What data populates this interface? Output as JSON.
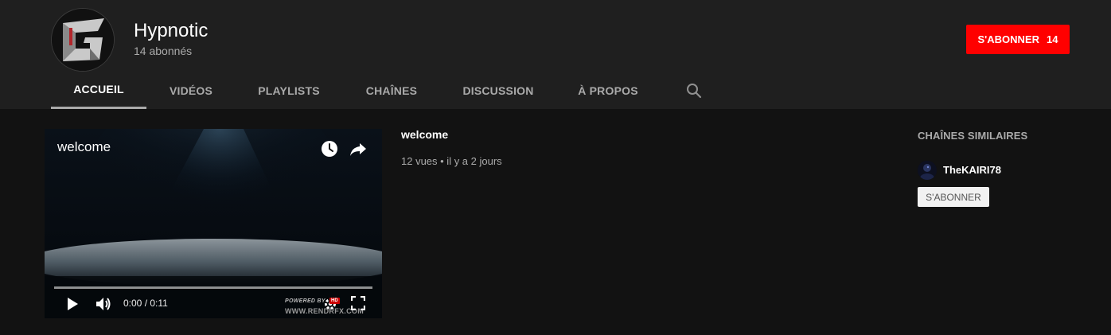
{
  "channel": {
    "name": "Hypnotic",
    "subscribers": "14 abonnés"
  },
  "subscribe_button": {
    "label": "S'ABONNER",
    "count": "14",
    "color": "#ff0000"
  },
  "tabs": [
    {
      "label": "ACCUEIL",
      "active": true
    },
    {
      "label": "VIDÉOS",
      "active": false
    },
    {
      "label": "PLAYLISTS",
      "active": false
    },
    {
      "label": "CHAÎNES",
      "active": false
    },
    {
      "label": "DISCUSSION",
      "active": false
    },
    {
      "label": "À PROPOS",
      "active": false
    }
  ],
  "featured_video": {
    "overlay_title": "welcome",
    "time": "0:00 / 0:11",
    "progress": 0,
    "watermark_line1": "POWERED BY",
    "watermark_line2": "WWW.RENDRFX.COM",
    "hd_badge": "HD",
    "title": "welcome",
    "meta": "12 vues • il y a 2 jours"
  },
  "related": {
    "heading": "CHAÎNES SIMILAIRES",
    "channels": [
      {
        "name": "TheKAIRI78",
        "subscribe_label": "S'ABONNER"
      }
    ]
  },
  "icons": {
    "search": "search-icon",
    "watch_later": "clock-icon",
    "share": "share-icon",
    "play": "play-icon",
    "volume": "volume-icon",
    "settings": "gear-icon",
    "fullscreen": "fullscreen-icon"
  }
}
